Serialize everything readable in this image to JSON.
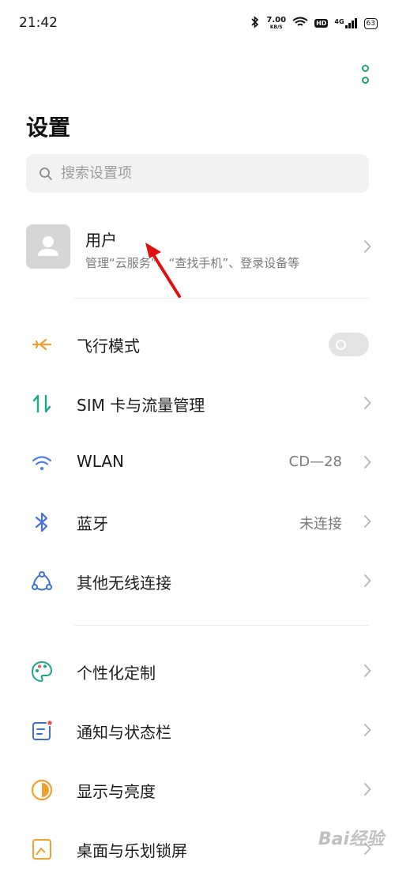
{
  "status_bar": {
    "time": "21:42",
    "net_speed": "7.00",
    "net_unit": "KB/S",
    "hd": "HD",
    "network": "4G",
    "battery": "63"
  },
  "page": {
    "title": "设置"
  },
  "search": {
    "placeholder": "搜索设置项"
  },
  "user": {
    "name": "用户",
    "description": "管理“云服务”、“查找手机”、登录设备等"
  },
  "rows": [
    {
      "label": "飞行模式",
      "icon": "airplane-icon",
      "toggle": false
    },
    {
      "label": "SIM 卡与流量管理",
      "icon": "sim-data-icon"
    },
    {
      "label": "WLAN",
      "icon": "wifi-icon",
      "value": "CD—28"
    },
    {
      "label": "蓝牙",
      "icon": "bluetooth-icon",
      "value": "未连接"
    },
    {
      "label": "其他无线连接",
      "icon": "wireless-connections-icon"
    },
    {
      "label": "个性化定制",
      "icon": "palette-icon"
    },
    {
      "label": "通知与状态栏",
      "icon": "notification-icon"
    },
    {
      "label": "显示与亮度",
      "icon": "brightness-icon"
    },
    {
      "label": "桌面与乐划锁屏",
      "icon": "desktop-lockscreen-icon"
    }
  ],
  "colors": {
    "accent_green": "#1f9e78",
    "airplane_orange": "#f0a030",
    "sim_teal": "#1aa68a",
    "wifi_blue": "#4a7fe0",
    "bluetooth_blue": "#4a72d8",
    "notification_red": "#e85a4f"
  },
  "watermark": "Bai经验"
}
